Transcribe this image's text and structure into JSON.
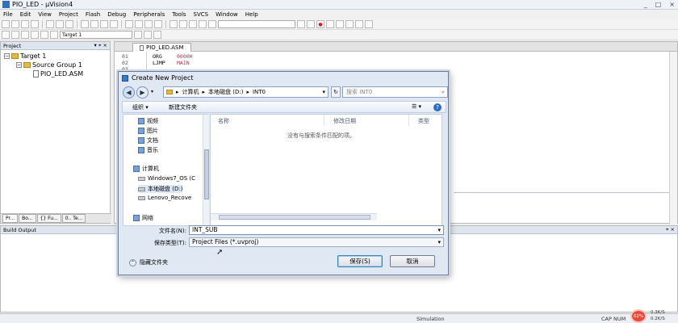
{
  "window": {
    "title": "PIO_LED - µVision4",
    "controls": [
      "_",
      "□",
      "×"
    ]
  },
  "menu": [
    "File",
    "Edit",
    "View",
    "Project",
    "Flash",
    "Debug",
    "Peripherals",
    "Tools",
    "SVCS",
    "Window",
    "Help"
  ],
  "toolbar2": {
    "target_select": "Target 1"
  },
  "project_pane": {
    "title": "Project",
    "pin_glyphs": "▾ ⌖ ×",
    "tree": [
      {
        "label": "Target 1",
        "level": 0
      },
      {
        "label": "Source Group 1",
        "level": 1
      },
      {
        "label": "PIO_LED.ASM",
        "level": 2
      }
    ],
    "tabs": [
      "Pr...",
      "Bo...",
      "{} Fu...",
      "0.. Te..."
    ]
  },
  "editor": {
    "tab_label": "PIO_LED.ASM",
    "lines": [
      {
        "num": "01",
        "keyword": "ORG",
        "operand": "0000H"
      },
      {
        "num": "02",
        "keyword": "LJMP",
        "operand": "MAIN"
      },
      {
        "num": "03",
        "keyword": "",
        "operand": ""
      }
    ]
  },
  "build_output": {
    "title": "Build Output"
  },
  "status_bar": {
    "mode": "Simulation",
    "caps": "CAP  NUM",
    "gauge": "62%",
    "net_up": "0.3K/S",
    "net_down": "0.2K/S"
  },
  "dialog": {
    "title": "Create New Project",
    "address_path": [
      "计算机",
      "本地磁盘 (D:)",
      "INT0"
    ],
    "search_placeholder": "搜索 INT0",
    "organize": "组织 ▾",
    "new_folder": "新建文件夹",
    "nav_items": [
      {
        "label": "视频",
        "icon": "video-icon"
      },
      {
        "label": "图片",
        "icon": "pictures-icon"
      },
      {
        "label": "文档",
        "icon": "documents-icon"
      },
      {
        "label": "音乐",
        "icon": "music-icon"
      },
      {
        "label": "计算机",
        "icon": "computer-icon"
      },
      {
        "label": "Windows7_OS (C",
        "icon": "drive-icon"
      },
      {
        "label": "本地磁盘 (D:)",
        "icon": "drive-icon"
      },
      {
        "label": "Lenovo_Recove",
        "icon": "drive-icon"
      },
      {
        "label": "网络",
        "icon": "network-icon"
      }
    ],
    "columns": [
      "名称",
      "修改日期",
      "类型"
    ],
    "empty_message": "没有与搜索条件匹配的项。",
    "filename_label": "文件名(N):",
    "filename_value": "INT_SUB",
    "filetype_label": "保存类型(T):",
    "filetype_value": "Project Files (*.uvproj)",
    "hide_folders": "隐藏文件夹",
    "save_button": "保存(S)",
    "cancel_button": "取消"
  }
}
